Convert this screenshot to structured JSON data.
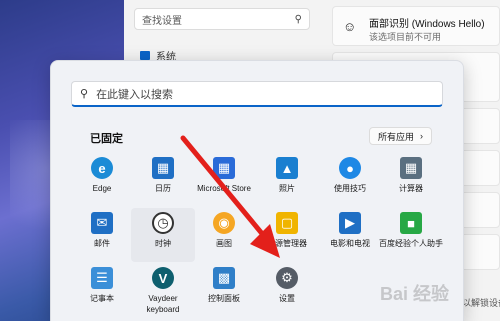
{
  "settings": {
    "search_placeholder": "查找设置",
    "system_label": "系统",
    "hello_title": "面部识别 (Windows Hello)",
    "hello_sub": "该选项目前不可用",
    "ghost_text": "以解锁设备"
  },
  "start_menu": {
    "search_placeholder": "在此键入以搜索",
    "pinned_label": "已固定",
    "all_apps_label": "所有应用",
    "apps": [
      {
        "label": "Edge",
        "icon": "edge-icon",
        "color": "#1b8bd6"
      },
      {
        "label": "日历",
        "icon": "calendar-icon",
        "color": "#1f6fc4"
      },
      {
        "label": "Microsoft Store",
        "icon": "store-icon",
        "color": "#2a6bd8"
      },
      {
        "label": "照片",
        "icon": "photos-icon",
        "color": "#1a7fd0"
      },
      {
        "label": "使用技巧",
        "icon": "tips-icon",
        "color": "#1e88e5"
      },
      {
        "label": "计算器",
        "icon": "calculator-icon",
        "color": "#5a6f80"
      },
      {
        "label": "邮件",
        "icon": "mail-icon",
        "color": "#1f6fc4"
      },
      {
        "label": "时钟",
        "icon": "clock-icon",
        "color": "#4a4a4a"
      },
      {
        "label": "画图",
        "icon": "paint-icon",
        "color": "#f5a623"
      },
      {
        "label": "资源管理器",
        "icon": "folder-icon",
        "color": "#f0b400"
      },
      {
        "label": "电影和电视",
        "icon": "movies-icon",
        "color": "#1f6fc4"
      },
      {
        "label": "百度经验个人助手",
        "icon": "baidu-icon",
        "color": "#27a845"
      },
      {
        "label": "记事本",
        "icon": "notepad-icon",
        "color": "#3b8fd8"
      },
      {
        "label": "Vaydeer keyboard",
        "icon": "vaydeer-icon",
        "color": "#0e5f6e"
      },
      {
        "label": "控制面板",
        "icon": "control-panel-icon",
        "color": "#2f7fc8"
      },
      {
        "label": "设置",
        "icon": "gear-icon",
        "color": "#555c66"
      }
    ]
  },
  "overlay": {
    "watermark": "Bai 经验"
  },
  "colors": {
    "accent": "#0a64c8",
    "arrow": "#e3201b"
  }
}
